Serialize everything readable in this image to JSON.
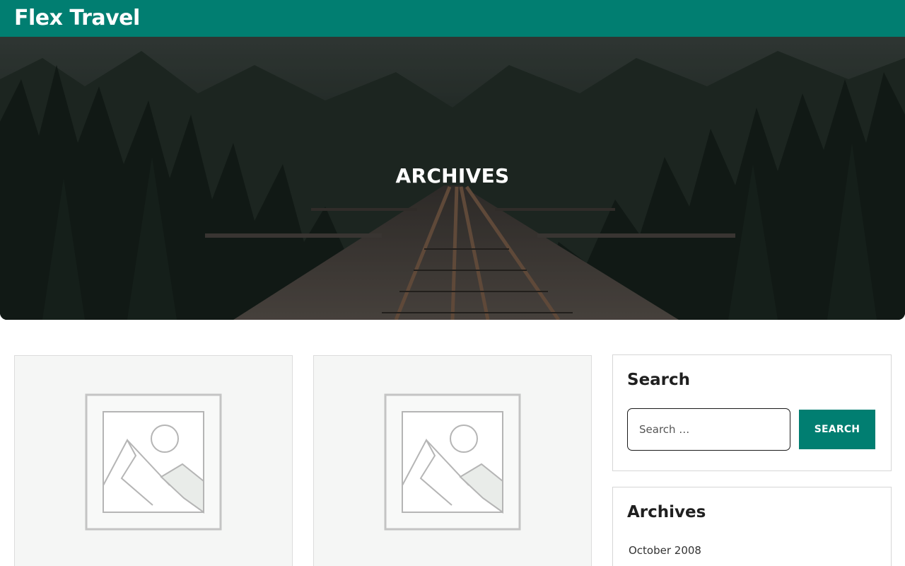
{
  "header": {
    "site_title": "Flex Travel",
    "background_color": "#017e71"
  },
  "hero": {
    "title": "ARCHIVES",
    "image_description": "forest-railway-bridge-photo"
  },
  "posts": [
    {
      "thumbnail_icon": "image-placeholder-icon"
    },
    {
      "thumbnail_icon": "image-placeholder-icon"
    }
  ],
  "sidebar": {
    "search_widget": {
      "title": "Search",
      "placeholder": "Search …",
      "button_label": "SEARCH"
    },
    "archives_widget": {
      "title": "Archives",
      "items": [
        "October 2008"
      ]
    }
  },
  "colors": {
    "accent": "#017e71",
    "card_background": "#f5f6f5"
  }
}
